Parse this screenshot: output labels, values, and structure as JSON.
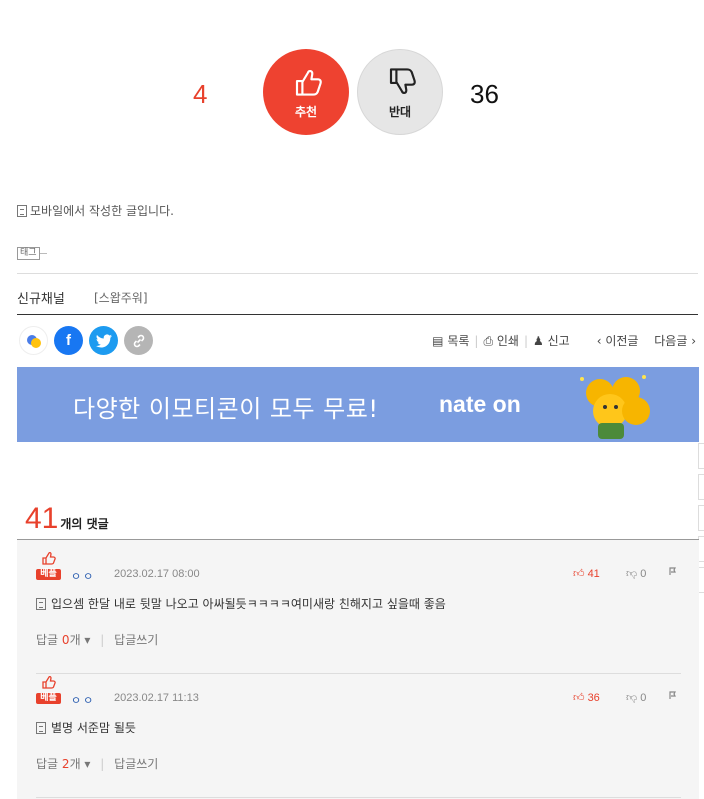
{
  "vote": {
    "up_count": "4",
    "up_label": "추천",
    "down_label": "반대",
    "down_count": "36"
  },
  "post": {
    "mobile_note": "모바일에서 작성한 글입니다.",
    "tag_label": "태그",
    "channel": "신규채널",
    "channel_sub": "[스왑주워]"
  },
  "toolbar": {
    "list": "목록",
    "print": "인쇄",
    "report": "신고",
    "prev": "‹ 이전글",
    "next": "다음글 ›"
  },
  "banner": {
    "text": "다양한 이모티콘이 모두 무료!",
    "logo": "nate on"
  },
  "comments_header": {
    "count": "41",
    "label": "개의 댓글"
  },
  "comments": [
    {
      "best": "베플",
      "name": "ㅇㅇ",
      "date": "2023.02.17 08:00",
      "up": "41",
      "down": "0",
      "text": "입으셈 한달 내로 뒷말 나오고 아싸될듯ㅋㅋㅋㅋ여미새랑 친해지고 싶을때 좋음",
      "reply_prefix": "답글",
      "reply_count": "0",
      "reply_suffix": "개 ▾",
      "write_reply": "답글쓰기"
    },
    {
      "best": "베플",
      "name": "ㅇㅇ",
      "date": "2023.02.17 11:13",
      "up": "36",
      "down": "0",
      "text": "별명 서준맘 될듯",
      "reply_prefix": "답글",
      "reply_count": "2",
      "reply_suffix": "개 ▾",
      "write_reply": "답글쓰기"
    }
  ]
}
